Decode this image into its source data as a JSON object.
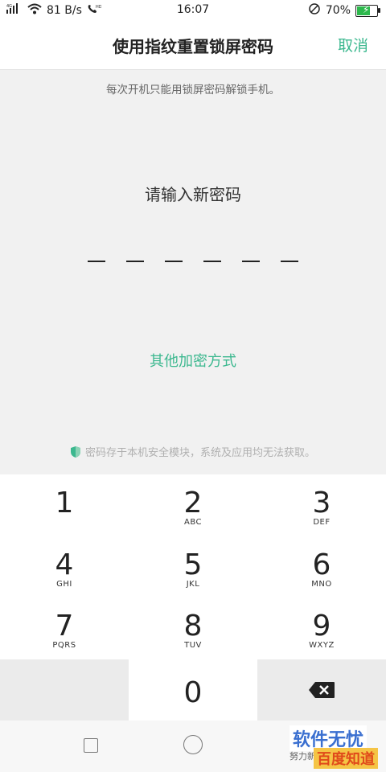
{
  "status": {
    "network_label": "4G",
    "speed": "81 B/s",
    "time": "16:07",
    "battery_percent": "70%",
    "battery_level": 0.7,
    "battery_color": "#2db84c"
  },
  "header": {
    "title": "使用指纹重置锁屏密码",
    "cancel_label": "取消",
    "accent_color": "#3cb88f"
  },
  "content": {
    "hint": "每次开机只能用锁屏密码解锁手机。",
    "prompt": "请输入新密码",
    "pin_length": 6,
    "other_method": "其他加密方式",
    "secure_note": "密码存于本机安全模块，系统及应用均无法获取。"
  },
  "keypad": {
    "keys": [
      {
        "num": "1",
        "letters": ""
      },
      {
        "num": "2",
        "letters": "ABC"
      },
      {
        "num": "3",
        "letters": "DEF"
      },
      {
        "num": "4",
        "letters": "GHI"
      },
      {
        "num": "5",
        "letters": "JKL"
      },
      {
        "num": "6",
        "letters": "MNO"
      },
      {
        "num": "7",
        "letters": "PQRS"
      },
      {
        "num": "8",
        "letters": "TUV"
      },
      {
        "num": "9",
        "letters": "WXYZ"
      },
      {
        "num": "0",
        "letters": ""
      }
    ],
    "delete_icon": "backspace-icon"
  },
  "navbar": {
    "icons": [
      "recent-apps-icon",
      "home-icon"
    ]
  },
  "watermark": {
    "top": "软件无忧",
    "small": "努力新",
    "bottom": "百度知道"
  }
}
